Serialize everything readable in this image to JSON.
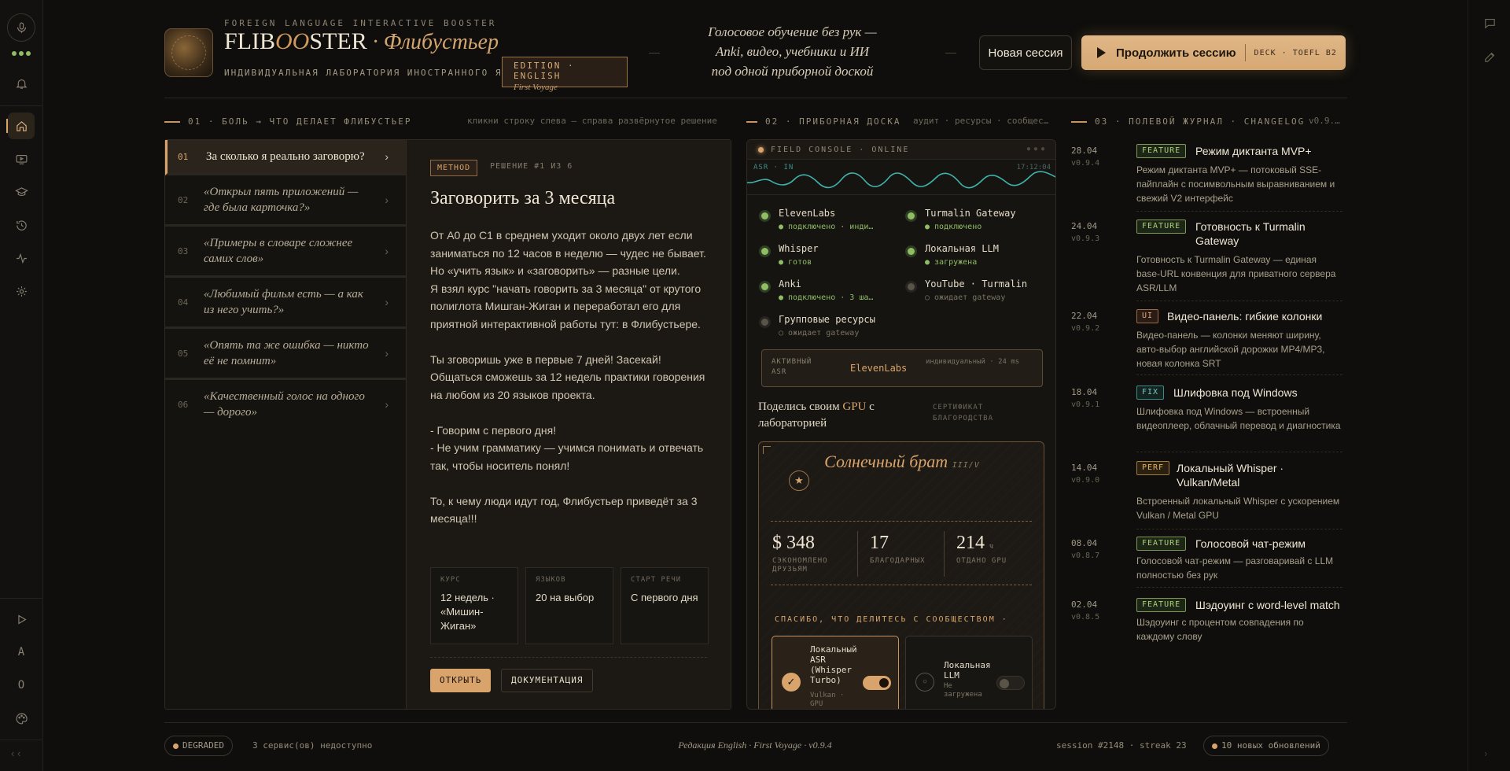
{
  "header": {
    "tag": "FOREIGN LANGUAGE INTERACTIVE BOOSTER",
    "brand_pre": "FLIB",
    "brand_oo": "OO",
    "brand_post": "STER",
    "brand_sep": " · ",
    "brand_ru": "Флибустьер",
    "subtitle": "ИНДИВИДУАЛЬНАЯ ЛАБОРАТОРИЯ ИНОСТРАННОГО ЯЗЫКА",
    "edition": "EDITION · ENGLISH",
    "edition_sub": "First Voyage",
    "tagline_1": "Голосовое обучение без рук —",
    "tagline_2": "Anki, видео, учебники и ИИ",
    "tagline_3": "под одной приборной доской",
    "new_session": "Новая сессия",
    "continue_session": "Продолжить сессию",
    "deck": "DECK · TOEFL B2"
  },
  "section1": {
    "label": "01 · БОЛЬ → ЧТО ДЕЛАЕТ ФЛИБУСТЬЕР",
    "hint": "кликни строку слева — справа развёрнутое решение",
    "questions": [
      {
        "num": "01",
        "text": "За сколько я реально заговорю?"
      },
      {
        "num": "02",
        "text": "«Открыл пять приложений — где была карточка?»"
      },
      {
        "num": "03",
        "text": "«Примеры в словаре сложнее самих слов»"
      },
      {
        "num": "04",
        "text": "«Любимый фильм есть — а как из него учить?»"
      },
      {
        "num": "05",
        "text": "«Опять та же ошибка — никто её не помнит»"
      },
      {
        "num": "06",
        "text": "«Качественный голос на одного — дорого»"
      }
    ],
    "method": "METHOD",
    "solution": "РЕШЕНИЕ #1 ИЗ 6",
    "title": "Заговорить за 3 месяца",
    "body": "От A0 до C1 в среднем уходит около двух лет если заниматься по 12 часов в неделю — чудес не бывает. Но «учить язык» и «заговорить» — разные цели.\nЯ взял курс \"начать говорить за 3 месяца\" от крутого полиглота Мишган-Жиган и переработал его для приятной интерактивной работы тут: в Флибустьере.\n\nТы зговоришь уже в первые 7 дней! Засекай!\nОбщаться сможешь за 12 недель практики говорения на любом из 20 языков проекта.\n\n- Говорим с первого дня!\n- Не учим грамматику — учимся понимать и отвечать так, чтобы носитель понял!\n\nТо, к чему люди идут год, Флибустьер приведёт за 3 месяца!!!",
    "stats": [
      {
        "label": "КУРС",
        "value": "12 недель · «Мишин-Жиган»"
      },
      {
        "label": "ЯЗЫКОВ",
        "value": "20 на выбор"
      },
      {
        "label": "СТАРТ РЕЧИ",
        "value": "С первого дня"
      }
    ],
    "open": "ОТКРЫТЬ",
    "docs": "ДОКУМЕНТАЦИЯ"
  },
  "section2": {
    "label": "02 · ПРИБОРНАЯ ДОСКА",
    "hint": "аудит · ресурсы · сообщес…",
    "console": "FIELD CONSOLE · ONLINE",
    "asr_in": "ASR · IN",
    "time": "17:12:04",
    "services": [
      {
        "name": "ElevenLabs",
        "status": "● подключено · инди…",
        "on": true
      },
      {
        "name": "Turmalin Gateway",
        "status": "● подключено",
        "on": true
      },
      {
        "name": "Whisper",
        "status": "● готов",
        "on": true
      },
      {
        "name": "Локальная LLM",
        "status": "● загружена",
        "on": true
      },
      {
        "name": "Anki",
        "status": "● подключено · 3 ша…",
        "on": true
      },
      {
        "name": "YouTube · Turmalin",
        "status": "○ ожидает gateway",
        "on": false
      },
      {
        "name": "Групповые ресурсы",
        "status": "○ ожидает gateway",
        "on": false
      }
    ],
    "active_asr_label": "АКТИВНЫЙ ASR",
    "active_asr_value": "ElevenLabs",
    "active_asr_note": "индивидуальный · 24 ms",
    "gpu_pre": "Поделись своим ",
    "gpu_word": "GPU",
    "gpu_post": " с лабораторией",
    "cert": "СЕРТИФИКАТ БЛАГОРОДСТВА",
    "card_title": "Солнечный брат",
    "card_rank": "III/V",
    "saved": "$ 348",
    "saved_label": "СЭКОНОМЛЕНО ДРУЗЬЯМ",
    "thanks_count": "17",
    "thanks_label": "БЛАГОДАРНЫХ",
    "gpu_hours": "214",
    "gpu_unit": "ч",
    "gpu_label": "ОТДАНО GPU",
    "thanks": "СПАСИБО, ЧТО ДЕЛИТЕСЬ С СООБЩЕСТВОМ ·",
    "opt1_name": "Локальный ASR (Whisper Turbo)",
    "opt1_sub": "Vulkan · GPU",
    "opt2_name": "Локальная LLM",
    "opt2_sub": "Не загружена"
  },
  "section3": {
    "label": "03 · ПОЛЕВОЙ ЖУРНАЛ · CHANGELOG",
    "ver": "v0.9.…",
    "entries": [
      {
        "date": "28.04",
        "ver": "v0.9.4",
        "badge": "FEATURE",
        "title": "Режим диктанта MVP+",
        "desc": "Режим диктанта MVP+ — потоковый SSE-пайплайн с посимвольным выравниванием и свежий V2 интерфейс"
      },
      {
        "date": "24.04",
        "ver": "v0.9.3",
        "badge": "FEATURE",
        "title": "Готовность к Turmalin Gateway",
        "desc": "Готовность к Turmalin Gateway — единая base-URL конвенция для приватного сервера ASR/LLM"
      },
      {
        "date": "22.04",
        "ver": "v0.9.2",
        "badge": "UI",
        "title": "Видео-панель: гибкие колонки",
        "desc": "Видео-панель — колонки меняют ширину, авто-выбор английской дорожки MP4/MP3, новая колонка SRT"
      },
      {
        "date": "18.04",
        "ver": "v0.9.1",
        "badge": "FIX",
        "title": "Шлифовка под Windows",
        "desc": "Шлифовка под Windows — встроенный видеоплеер, облачный перевод и диагностика"
      },
      {
        "date": "14.04",
        "ver": "v0.9.0",
        "badge": "PERF",
        "title": "Локальный Whisper · Vulkan/Metal",
        "desc": "Встроенный локальный Whisper с ускорением Vulkan / Metal GPU"
      },
      {
        "date": "08.04",
        "ver": "v0.8.7",
        "badge": "FEATURE",
        "title": "Голосовой чат-режим",
        "desc": "Голосовой чат-режим — разговаривай с LLM полностью без рук"
      },
      {
        "date": "02.04",
        "ver": "v0.8.5",
        "badge": "FEATURE",
        "title": "Шэдоуинг с word-level match",
        "desc": "Шэдоуинг с процентом совпадения по каждому слову"
      }
    ]
  },
  "footer": {
    "status": "DEGRADED",
    "services_down": "3 сервис(ов) недоступно",
    "center": "Редакция English · First Voyage · v0.9.4",
    "session": "session #2148 · streak 23",
    "updates": "10 новых обновлений"
  },
  "rail": {
    "letters": [
      "A",
      "O"
    ]
  }
}
